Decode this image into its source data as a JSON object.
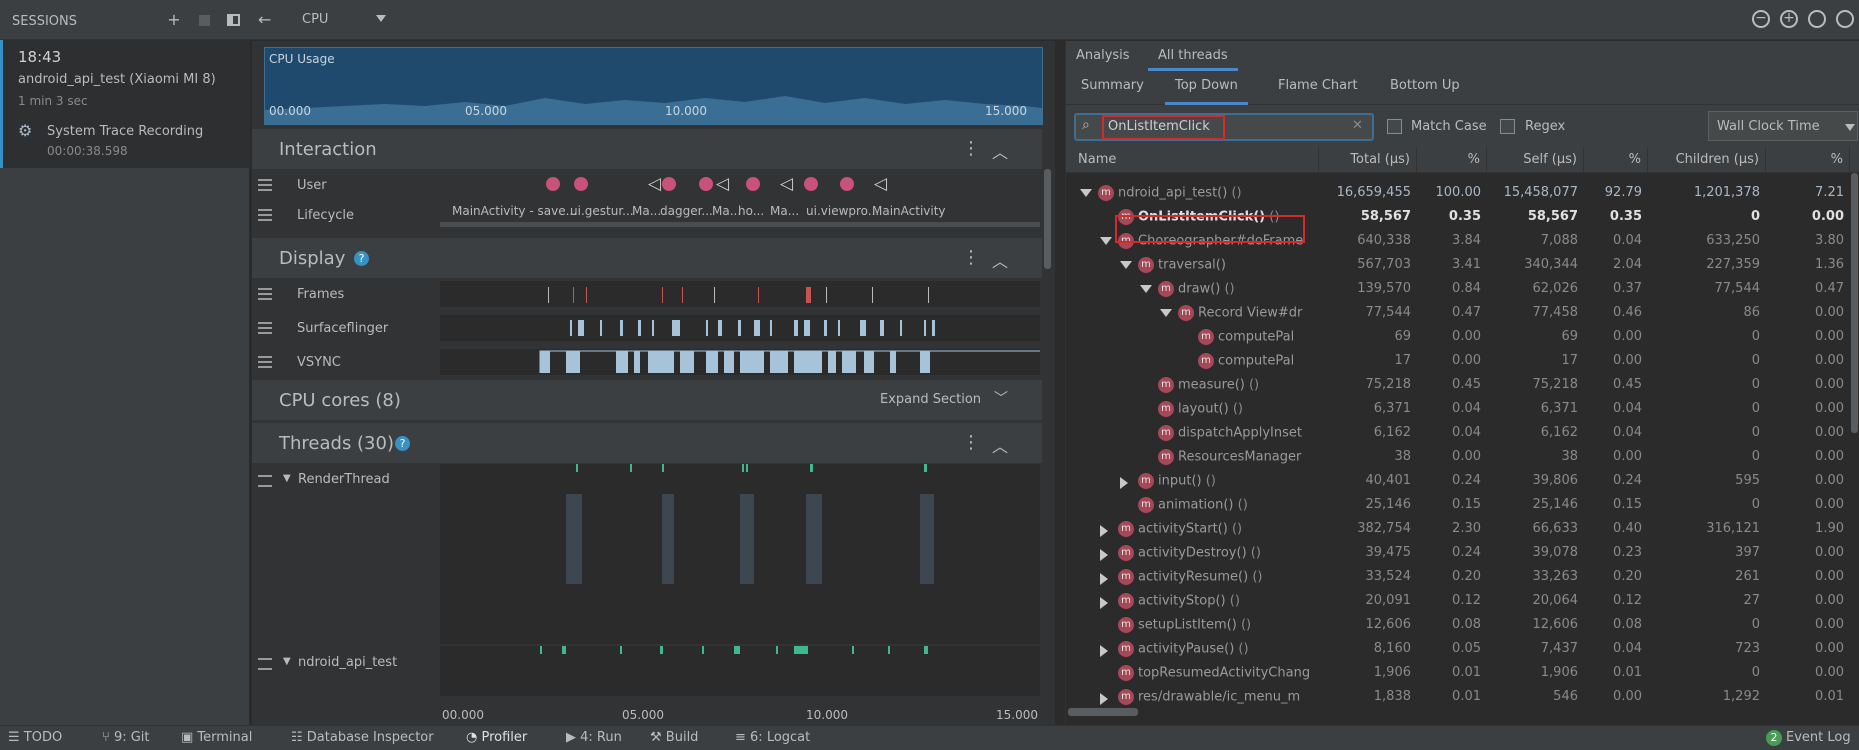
{
  "sessions": {
    "title": "SESSIONS",
    "time": "18:43",
    "app": "android_api_test (Xiaomi MI 8)",
    "duration": "1 min 3 sec",
    "recording": "System Trace Recording",
    "recording_time": "00:00:38.598"
  },
  "toolbar": {
    "profiler": "CPU"
  },
  "timeline": {
    "cpu_usage_label": "CPU Usage",
    "cpu_ticks": [
      "00.000",
      "05.000",
      "10.000",
      "15.000"
    ],
    "interaction": "Interaction",
    "user": "User",
    "lifecycle": "Lifecycle",
    "lifecycle_labels": [
      "MainActivity - save...",
      "ui.gestur...",
      "Ma...",
      "dagger...",
      "Ma...",
      "ho...",
      "Ma...",
      "ui.viewpro...",
      "MainActivity"
    ],
    "display": "Display",
    "frames": "Frames",
    "surfaceflinger": "Surfaceflinger",
    "vsync": "VSYNC",
    "cpu_cores": "CPU cores (8)",
    "expand_section": "Expand Section",
    "threads": "Threads (30)",
    "render_thread": "RenderThread",
    "api_thread": "ndroid_api_test",
    "bottom_ticks": [
      "00.000",
      "05.000",
      "10.000",
      "15.000"
    ]
  },
  "analysis": {
    "tabs": [
      "Analysis",
      "All threads"
    ],
    "subtabs": [
      "Summary",
      "Top Down",
      "Flame Chart",
      "Bottom Up"
    ],
    "search_value": "OnListItemClick",
    "match_case": "Match Case",
    "regex": "Regex",
    "clock": "Wall Clock Time",
    "columns": [
      "Name",
      "Total (µs)",
      "%",
      "Self (µs)",
      "%",
      "Children (µs)",
      "%"
    ],
    "rows": [
      {
        "indent": 0,
        "tri": "down",
        "name": "ndroid_api_test()",
        "args": "()",
        "total": "16,659,455",
        "tp": "100.00",
        "self": "15,458,077",
        "sp": "92.79",
        "children": "1,201,378",
        "cp": "7.21"
      },
      {
        "indent": 1,
        "tri": "",
        "name": "OnListItemClick()",
        "args": "()",
        "total": "58,567",
        "tp": "0.35",
        "self": "58,567",
        "sp": "0.35",
        "children": "0",
        "cp": "0.00",
        "bold": true
      },
      {
        "indent": 1,
        "tri": "down",
        "name": "Choreographer#doFrame",
        "args": "",
        "total": "640,338",
        "tp": "3.84",
        "self": "7,088",
        "sp": "0.04",
        "children": "633,250",
        "cp": "3.80"
      },
      {
        "indent": 2,
        "tri": "down",
        "name": "traversal()",
        "args": "",
        "total": "567,703",
        "tp": "3.41",
        "self": "340,344",
        "sp": "2.04",
        "children": "227,359",
        "cp": "1.36"
      },
      {
        "indent": 3,
        "tri": "down",
        "name": "draw()",
        "args": "()",
        "total": "139,570",
        "tp": "0.84",
        "self": "62,026",
        "sp": "0.37",
        "children": "77,544",
        "cp": "0.47"
      },
      {
        "indent": 4,
        "tri": "down",
        "name": "Record View#dr",
        "args": "",
        "total": "77,544",
        "tp": "0.47",
        "self": "77,458",
        "sp": "0.46",
        "children": "86",
        "cp": "0.00"
      },
      {
        "indent": 5,
        "tri": "",
        "name": "computePal",
        "args": "",
        "total": "69",
        "tp": "0.00",
        "self": "69",
        "sp": "0.00",
        "children": "0",
        "cp": "0.00"
      },
      {
        "indent": 5,
        "tri": "",
        "name": "computePal",
        "args": "",
        "total": "17",
        "tp": "0.00",
        "self": "17",
        "sp": "0.00",
        "children": "0",
        "cp": "0.00"
      },
      {
        "indent": 3,
        "tri": "",
        "name": "measure()",
        "args": "()",
        "total": "75,218",
        "tp": "0.45",
        "self": "75,218",
        "sp": "0.45",
        "children": "0",
        "cp": "0.00"
      },
      {
        "indent": 3,
        "tri": "",
        "name": "layout()",
        "args": "()",
        "total": "6,371",
        "tp": "0.04",
        "self": "6,371",
        "sp": "0.04",
        "children": "0",
        "cp": "0.00"
      },
      {
        "indent": 3,
        "tri": "",
        "name": "dispatchApplyInset",
        "args": "",
        "total": "6,162",
        "tp": "0.04",
        "self": "6,162",
        "sp": "0.04",
        "children": "0",
        "cp": "0.00"
      },
      {
        "indent": 3,
        "tri": "",
        "name": "ResourcesManager",
        "args": "",
        "total": "38",
        "tp": "0.00",
        "self": "38",
        "sp": "0.00",
        "children": "0",
        "cp": "0.00"
      },
      {
        "indent": 2,
        "tri": "right",
        "name": "input()",
        "args": "()",
        "total": "40,401",
        "tp": "0.24",
        "self": "39,806",
        "sp": "0.24",
        "children": "595",
        "cp": "0.00"
      },
      {
        "indent": 2,
        "tri": "",
        "name": "animation()",
        "args": "()",
        "total": "25,146",
        "tp": "0.15",
        "self": "25,146",
        "sp": "0.15",
        "children": "0",
        "cp": "0.00"
      },
      {
        "indent": 1,
        "tri": "right",
        "name": "activityStart()",
        "args": "()",
        "total": "382,754",
        "tp": "2.30",
        "self": "66,633",
        "sp": "0.40",
        "children": "316,121",
        "cp": "1.90"
      },
      {
        "indent": 1,
        "tri": "right",
        "name": "activityDestroy()",
        "args": "()",
        "total": "39,475",
        "tp": "0.24",
        "self": "39,078",
        "sp": "0.23",
        "children": "397",
        "cp": "0.00"
      },
      {
        "indent": 1,
        "tri": "right",
        "name": "activityResume()",
        "args": "()",
        "total": "33,524",
        "tp": "0.20",
        "self": "33,263",
        "sp": "0.20",
        "children": "261",
        "cp": "0.00"
      },
      {
        "indent": 1,
        "tri": "right",
        "name": "activityStop()",
        "args": "()",
        "total": "20,091",
        "tp": "0.12",
        "self": "20,064",
        "sp": "0.12",
        "children": "27",
        "cp": "0.00"
      },
      {
        "indent": 1,
        "tri": "",
        "name": "setupListItem()",
        "args": "()",
        "total": "12,606",
        "tp": "0.08",
        "self": "12,606",
        "sp": "0.08",
        "children": "0",
        "cp": "0.00"
      },
      {
        "indent": 1,
        "tri": "right",
        "name": "activityPause()",
        "args": "()",
        "total": "8,160",
        "tp": "0.05",
        "self": "7,437",
        "sp": "0.04",
        "children": "723",
        "cp": "0.00"
      },
      {
        "indent": 1,
        "tri": "",
        "name": "topResumedActivityChang",
        "args": "",
        "total": "1,906",
        "tp": "0.01",
        "self": "1,906",
        "sp": "0.01",
        "children": "0",
        "cp": "0.00"
      },
      {
        "indent": 1,
        "tri": "right",
        "name": "res/drawable/ic_menu_m",
        "args": "",
        "total": "1,838",
        "tp": "0.01",
        "self": "546",
        "sp": "0.00",
        "children": "1,292",
        "cp": "0.01"
      }
    ]
  },
  "statusbar": {
    "todo": "TODO",
    "git": "9: Git",
    "terminal": "Terminal",
    "db": "Database Inspector",
    "profiler": "Profiler",
    "run": "4: Run",
    "build": "Build",
    "logcat": "6: Logcat",
    "event_count": "2",
    "event_log": "Event Log"
  },
  "colors": {
    "accent": "#3592c4",
    "method_icon": "#a54858",
    "highlight": "#d42a2a",
    "cpu_fill": "#1f4a6e"
  }
}
